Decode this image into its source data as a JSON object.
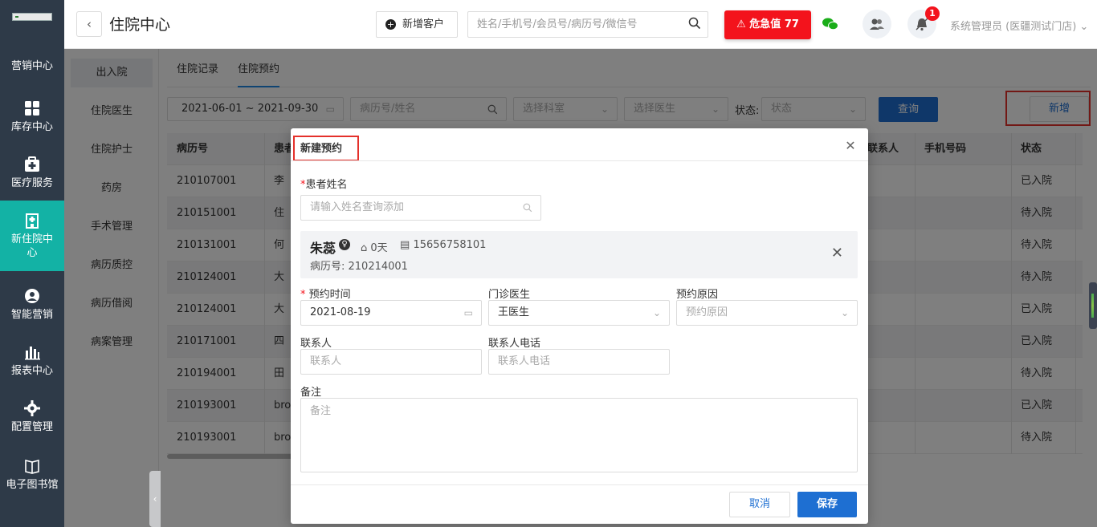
{
  "nav": {
    "items": [
      {
        "label": "营销中心",
        "icon": "marketing-icon"
      },
      {
        "label": "库存中心",
        "icon": "grid-icon"
      },
      {
        "label": "医疗服务",
        "icon": "medical-kit-icon"
      },
      {
        "label": "新住院中心",
        "icon": "hospital-icon"
      },
      {
        "label": "智能营销",
        "icon": "smart-marketing-icon"
      },
      {
        "label": "报表中心",
        "icon": "bar-chart-icon"
      },
      {
        "label": "配置管理",
        "icon": "gear-icon"
      },
      {
        "label": "电子图书馆",
        "icon": "book-icon"
      }
    ]
  },
  "header": {
    "title": "住院中心",
    "add_customer": "新增客户",
    "search_placeholder": "姓名/手机号/会员号/病历号/微信号",
    "danger_label": "危急值",
    "danger_count": "77",
    "notification_count": "1",
    "user": "系统管理员 (医疆测试门店)"
  },
  "subnav": {
    "items": [
      "出入院",
      "住院医生",
      "住院护士",
      "药房",
      "手术管理",
      "病历质控",
      "病历借阅",
      "病案管理"
    ]
  },
  "tabs": [
    "住院记录",
    "住院预约"
  ],
  "filters": {
    "date_range": "2021-06-01  ~  2021-09-30",
    "record_placeholder": "病历号/姓名",
    "department_placeholder": "选择科室",
    "doctor_placeholder": "选择医生",
    "status_label": "状态:",
    "status_placeholder": "状态",
    "query": "查询",
    "add": "新增"
  },
  "table": {
    "headers": [
      "病历号",
      "患者",
      "联系人",
      "手机号码",
      "状态"
    ],
    "rows": [
      {
        "record": "210107001",
        "patient": "李",
        "status": "已入院"
      },
      {
        "record": "210151001",
        "patient": "住",
        "status": "待入院"
      },
      {
        "record": "210131001",
        "patient": "何",
        "status": "待入院"
      },
      {
        "record": "210124001",
        "patient": "大",
        "status": "待入院"
      },
      {
        "record": "210124001",
        "patient": "大",
        "status": "已入院"
      },
      {
        "record": "210171001",
        "patient": "四",
        "status": "已入院"
      },
      {
        "record": "210194001",
        "patient": "田",
        "status": "待入院"
      },
      {
        "record": "210193001",
        "patient": "bro",
        "status": "已入院"
      },
      {
        "record": "210193001",
        "patient": "bro",
        "status": "待入院"
      }
    ]
  },
  "modal": {
    "title": "新建预约",
    "patient_name_label": "患者姓名",
    "patient_search_placeholder": "请输入姓名查询添加",
    "patient": {
      "name": "朱蕊",
      "age": "0天",
      "phone": "15656758101",
      "record": "病历号: 210214001"
    },
    "appointment_time_label": "预约时间",
    "appointment_time_value": "2021-08-19",
    "doctor_label": "门诊医生",
    "doctor_value": "王医生",
    "reason_label": "预约原因",
    "reason_placeholder": "预约原因",
    "contact_label": "联系人",
    "contact_placeholder": "联系人",
    "contact_phone_label": "联系人电话",
    "contact_phone_placeholder": "联系人电话",
    "note_label": "备注",
    "note_placeholder": "备注",
    "cancel": "取消",
    "save": "保存"
  },
  "colors": {
    "nav_bg": "#2e3a48",
    "nav_active": "#13b2a5",
    "primary": "#1e6fd2",
    "danger": "#f3131c",
    "highlight_frame": "#e4312b"
  }
}
